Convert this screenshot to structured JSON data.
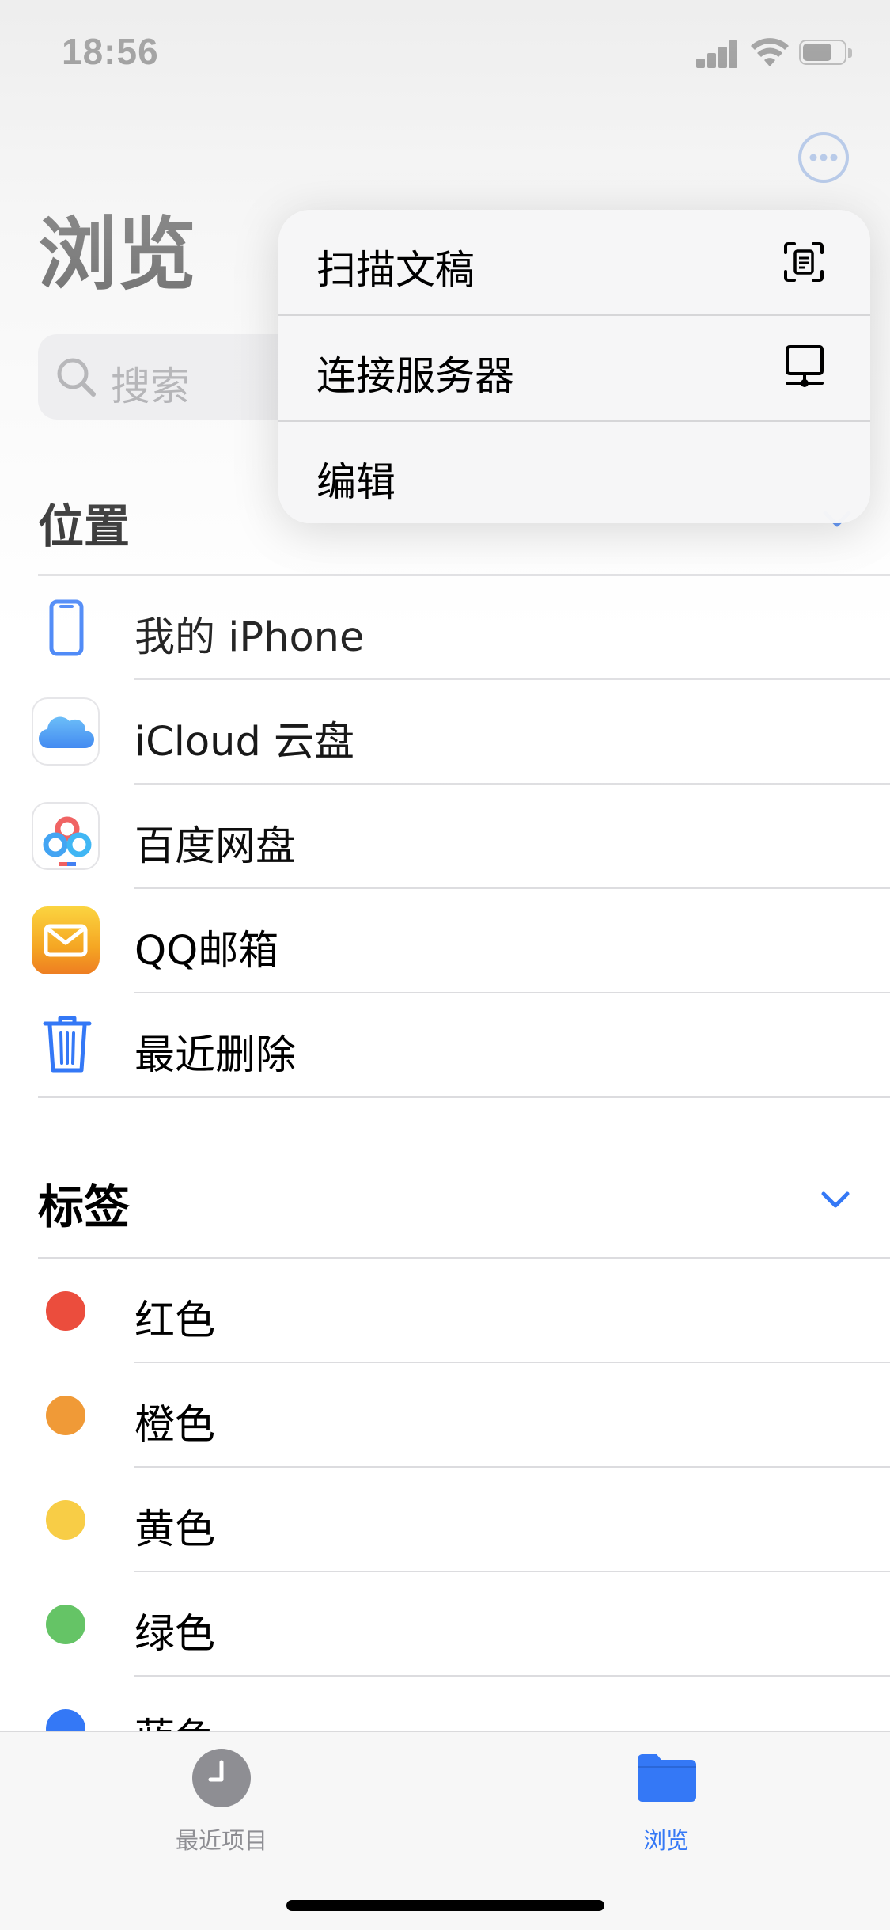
{
  "status_bar": {
    "time": "18:56"
  },
  "header": {
    "title": "浏览",
    "more_button_icon": "ellipsis-circle-icon"
  },
  "search": {
    "placeholder": "搜索"
  },
  "locations": {
    "title": "位置",
    "items": [
      {
        "label": "我的 iPhone",
        "icon": "iphone-icon"
      },
      {
        "label": "iCloud 云盘",
        "icon": "icloud-icon"
      },
      {
        "label": "百度网盘",
        "icon": "baidu-netdisk-icon"
      },
      {
        "label": "QQ邮箱",
        "icon": "qq-mail-icon"
      },
      {
        "label": "最近删除",
        "icon": "trash-icon"
      }
    ]
  },
  "tags": {
    "title": "标签",
    "items": [
      {
        "label": "红色",
        "color": "#eb4d3d"
      },
      {
        "label": "橙色",
        "color": "#f09a37"
      },
      {
        "label": "黄色",
        "color": "#f8cd46"
      },
      {
        "label": "绿色",
        "color": "#65c466"
      },
      {
        "label": "蓝色",
        "color": "#3478f6"
      }
    ]
  },
  "context_menu": {
    "items": [
      {
        "label": "扫描文稿",
        "icon": "doc-viewfinder-icon"
      },
      {
        "label": "连接服务器",
        "icon": "server-icon"
      },
      {
        "label": "编辑",
        "icon": ""
      }
    ]
  },
  "tab_bar": {
    "tabs": [
      {
        "label": "最近项目",
        "icon": "clock-icon",
        "active": false
      },
      {
        "label": "浏览",
        "icon": "folder-icon",
        "active": true
      }
    ]
  },
  "colors": {
    "accent": "#3478f6",
    "inactive_tab": "#8e8e93"
  }
}
